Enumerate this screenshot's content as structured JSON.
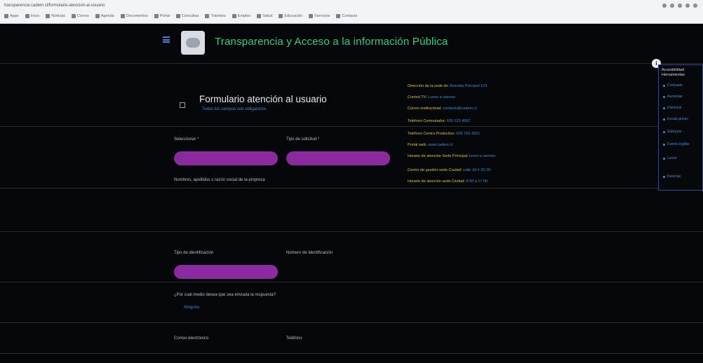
{
  "browser": {
    "url": "transparencia.cadem.cl/formulario-atencion-al-usuario",
    "bookmarks": [
      "Apps",
      "Inicio",
      "Noticias",
      "Correo",
      "Agenda",
      "Documentos",
      "Portal",
      "Consultas",
      "Trámites",
      "Empleo",
      "Salud",
      "Educación",
      "Servicios",
      "Contacto"
    ]
  },
  "header": {
    "title": "Transparencia y Acceso a la información Pública"
  },
  "form": {
    "title": "Formulario atención al usuario",
    "subtitle": "Todos los campos son obligatorios",
    "labels": {
      "selecciona": "Seleccionar *",
      "tipo_solicitud": "Tipo de solicitud *",
      "nombres": "Nombres, apellidos o razón social de la empresa",
      "tipo_id": "Tipo de identificación",
      "numero_id": "Número de identificación",
      "hint": "¿Por cual medio desea que sea enviada la respuesta?",
      "email": "Correo electrónico",
      "phone": "Teléfono"
    },
    "link_text": "Ninguno"
  },
  "info": {
    "rows": [
      {
        "label": "Dirección de la sede de:",
        "value": "Avenida Principal 123"
      },
      {
        "label": "Control TV:",
        "value": "Lunes a viernes"
      },
      {
        "label": "Correo institucional:",
        "value": "contacto@cadem.cl"
      },
      {
        "label": "Teléfono Conmutador:",
        "value": "600 123 4567"
      },
      {
        "label": "Teléfono Centro Productivo:",
        "value": "600 765 4321"
      },
      {
        "label": "Portal web:",
        "value": "www.cadem.cl"
      },
      {
        "label": "Horario de atención Sede Principal:",
        "value": "lunes a viernes"
      },
      {
        "label": "Centro de gestión sede Ciudad:",
        "value": "calle 10 # 20-30"
      },
      {
        "label": "Horario de atención sede Ciudad:",
        "value": "8:00 a 17:00"
      }
    ]
  },
  "sidebar": {
    "title": "Accesibilidad",
    "subtitle": "Herramientas",
    "items": [
      "Contraste",
      "Aumentar",
      "Disminuir",
      "Escala grises",
      "Subrayar",
      "Fuente legible",
      "Lector",
      "Reiniciar"
    ]
  },
  "colors": {
    "accent": "#2fd08a",
    "field": "#8a2a9e",
    "link": "#3f8fd8"
  },
  "icons": {
    "menu": "hamburger-icon",
    "logo": "site-logo",
    "accessibility": "accessibility-icon"
  }
}
